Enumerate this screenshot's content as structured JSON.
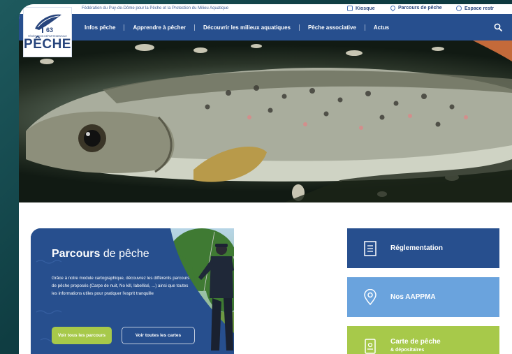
{
  "topbar": {
    "federation_text": "Fédération du Puy-de-Dôme pour la Pêche et la Protection du Milieu Aquatique",
    "links": [
      {
        "label": "Kiosque",
        "icon": "kiosk-icon"
      },
      {
        "label": "Parcours de pêche",
        "icon": "location-pin-icon"
      },
      {
        "label": "Espace restr",
        "icon": "user-icon"
      }
    ]
  },
  "logo": {
    "number": "63",
    "small_text": "FÉDÉRATION DÉPARTEMENTALE",
    "big_text": "PÊCHE"
  },
  "nav": {
    "items": [
      {
        "label": "Infos pêche"
      },
      {
        "label": "Apprendre à pêcher"
      },
      {
        "label": "Découvrir les milieux aquatiques"
      },
      {
        "label": "Pêche associative"
      },
      {
        "label": "Actus"
      }
    ],
    "search_icon": "search-icon"
  },
  "parcours": {
    "title_bold": "Parcours",
    "title_rest": " de pêche",
    "description": "Grâce à notre module cartographique, découvrez les différents parcours de pêche proposés (Carpe de nuit, No kill, labellisé, ...) ainsi que toutes les informations utiles pour pratiquer l'esprit tranquille",
    "button_primary": "Voir tous les parcours",
    "button_secondary": "Voir toutes les cartes"
  },
  "tiles": [
    {
      "label": "Réglementation",
      "icon": "document-icon"
    },
    {
      "label": "Nos AAPPMA",
      "icon": "location-pin-icon"
    },
    {
      "label": "Carte de pêche",
      "sublabel": "& dépositaires",
      "icon": "card-icon"
    }
  ],
  "colors": {
    "primary_blue": "#274f8e",
    "light_blue": "#6aa3dd",
    "green": "#a7c94a",
    "background": "#0f3d42"
  }
}
